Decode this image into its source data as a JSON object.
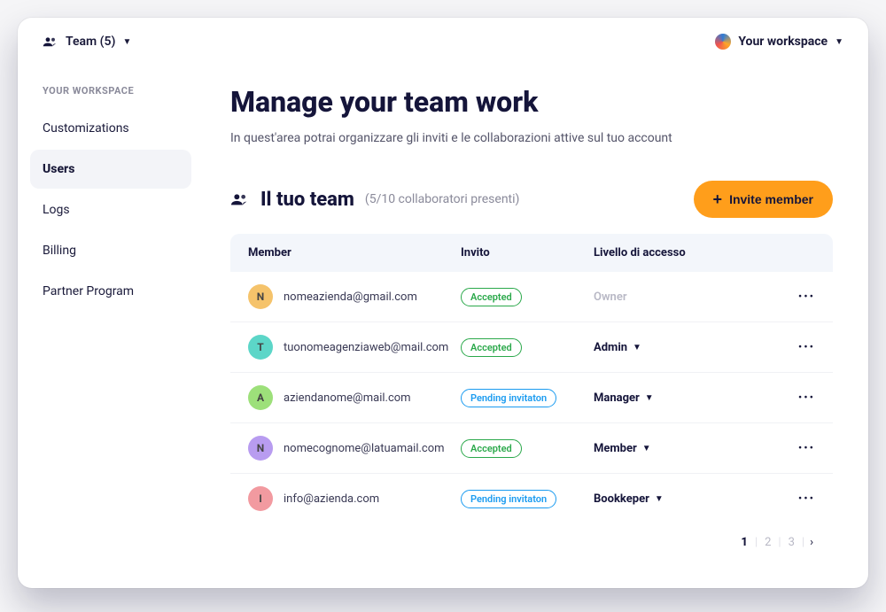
{
  "topbar": {
    "team_label": "Team (5)",
    "workspace_label": "Your workspace"
  },
  "sidebar": {
    "header": "YOUR WORKSPACE",
    "items": [
      {
        "label": "Customizations",
        "active": false
      },
      {
        "label": "Users",
        "active": true
      },
      {
        "label": "Logs",
        "active": false
      },
      {
        "label": "Billing",
        "active": false
      },
      {
        "label": "Partner Program",
        "active": false
      }
    ]
  },
  "page": {
    "title": "Manage your team work",
    "subtitle": "In quest'area potrai organizzare gli inviti e le collaborazioni attive sul tuo account"
  },
  "team_section": {
    "title": "Il tuo team",
    "count": "(5/10 collaboratori presenti)",
    "invite_label": "Invite member"
  },
  "table": {
    "headers": {
      "member": "Member",
      "invite": "Invito",
      "access": "Livello di accesso"
    },
    "badge_labels": {
      "accepted": "Accepted",
      "pending": "Pending invitaton"
    },
    "rows": [
      {
        "initial": "N",
        "avatar_color": "#f5c36b",
        "email": "nomeazienda@gmail.com",
        "invite": "accepted",
        "access": "Owner",
        "editable": false
      },
      {
        "initial": "T",
        "avatar_color": "#5cd6c8",
        "email": "tuonomeagenziaweb@mail.com",
        "invite": "accepted",
        "access": "Admin",
        "editable": true
      },
      {
        "initial": "A",
        "avatar_color": "#9de07a",
        "email": "aziendanome@mail.com",
        "invite": "pending",
        "access": "Manager",
        "editable": true
      },
      {
        "initial": "N",
        "avatar_color": "#b89cf0",
        "email": "nomecognome@latuamail.com",
        "invite": "accepted",
        "access": "Member",
        "editable": true
      },
      {
        "initial": "I",
        "avatar_color": "#f29aa0",
        "email": "info@azienda.com",
        "invite": "pending",
        "access": "Bookkeper",
        "editable": true
      }
    ]
  },
  "pagination": {
    "pages": [
      "1",
      "2",
      "3"
    ],
    "active": "1"
  }
}
